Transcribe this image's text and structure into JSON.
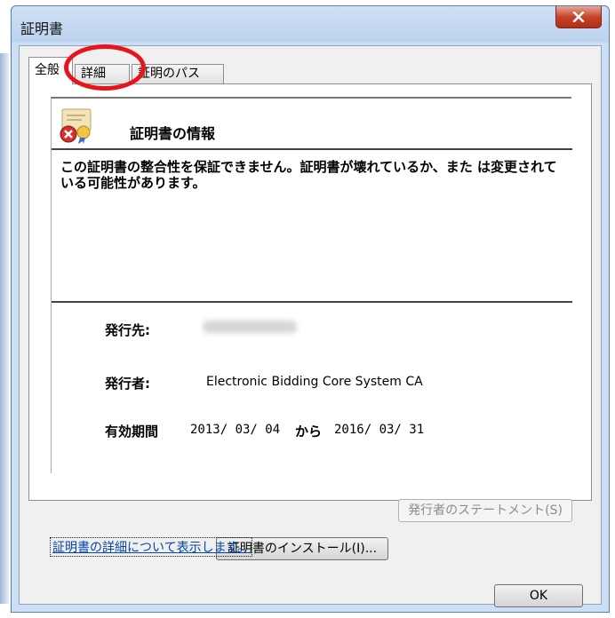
{
  "window": {
    "title": "証明書",
    "close_icon": "close-icon"
  },
  "tabs": [
    {
      "label": "全般",
      "active": true
    },
    {
      "label": "詳細",
      "active": false
    },
    {
      "label": "証明のパス",
      "active": false
    }
  ],
  "info": {
    "icon": "certificate-error-icon",
    "title": "証明書の情報",
    "warning": "この証明書の整合性を保証できません。証明書が壊れているか、また は変更されている可能性があります。"
  },
  "fields": {
    "issued_to_label": "発行先:",
    "issued_to_value": "",
    "issued_by_label": "発行者:",
    "issued_by_value": "Electronic Bidding Core System CA",
    "validity_label": "有効期間",
    "valid_from": "2013/ 03/ 04",
    "validity_from_word": "から",
    "valid_to": "2016/ 03/ 31"
  },
  "buttons": {
    "install": "証明書のインストール(I)...",
    "issuer_statement": "発行者のステートメント(S)",
    "ok": "OK"
  },
  "link": {
    "details": "証明書の詳細について表示します。"
  },
  "colors": {
    "annotation": "#e8141c",
    "close_button": "#c7442b",
    "link": "#0645ad"
  }
}
